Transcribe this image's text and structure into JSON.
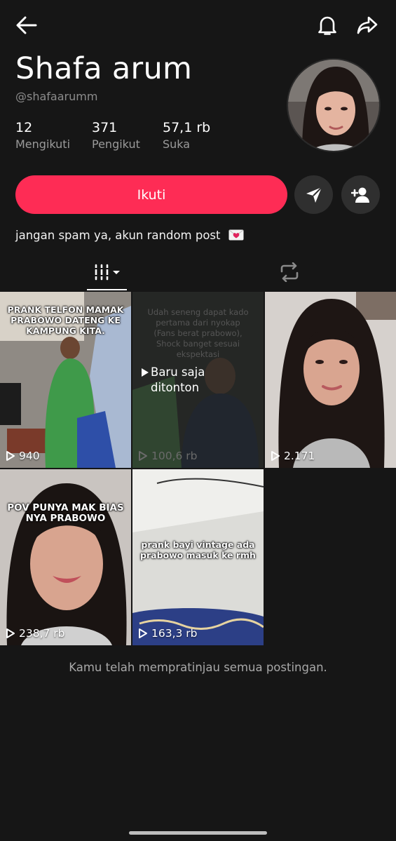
{
  "profile": {
    "display_name": "Shafa arum",
    "username": "@shafaarumm",
    "stats": [
      {
        "value": "12",
        "label": "Mengikuti"
      },
      {
        "value": "371",
        "label": "Pengikut"
      },
      {
        "value": "57,1 rb",
        "label": "Suka"
      }
    ],
    "bio": "jangan spam ya, akun random post",
    "bio_emoji": "love-letter-icon"
  },
  "actions": {
    "follow_label": "Ikuti",
    "message_icon": "send-icon",
    "add_friend_icon": "add-user-icon"
  },
  "topbar": {
    "back_icon": "back-arrow-icon",
    "bell_icon": "bell-icon",
    "share_icon": "share-icon"
  },
  "tabs": [
    {
      "name": "videos",
      "icon": "grid-icon",
      "active": true
    },
    {
      "name": "reposts",
      "icon": "repost-icon",
      "active": false
    }
  ],
  "videos": [
    {
      "views": "940",
      "caption": "PRANK TELFON MAMAK PRABOWO DATENG KE KAMPUNG KITA."
    },
    {
      "views": "100,6 rb",
      "caption": "Udah seneng dapat kado pertama dari nyokap (Fans berat prabowo), Shock banget sesuai ekspektasi",
      "badge": "Baru saja ditonton"
    },
    {
      "views": "2.171",
      "caption": ""
    },
    {
      "views": "238,7 rb",
      "caption": "POV PUNYA MAK BIAS NYA PRABOWO"
    },
    {
      "views": "163,3 rb",
      "caption": "prank bayi vintage ada prabowo masuk ke rmh"
    }
  ],
  "footer": {
    "text": "Kamu telah mempratinjau semua postingan."
  },
  "colors": {
    "background": "#161616",
    "accent": "#fe2c55",
    "secondary_button": "#2f2f2f"
  }
}
